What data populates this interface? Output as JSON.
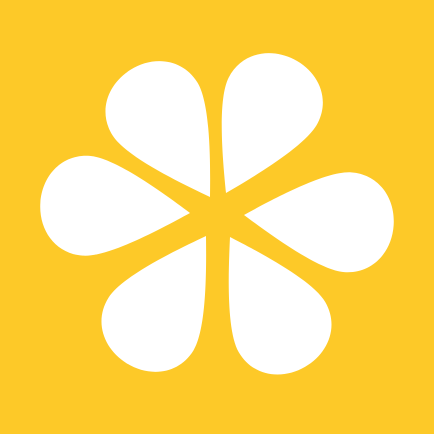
{
  "app_icon": {
    "icon": "flower-icon",
    "background_color": "#FDC928",
    "petal_color": "#FFFFFF",
    "petal_count": 6
  }
}
